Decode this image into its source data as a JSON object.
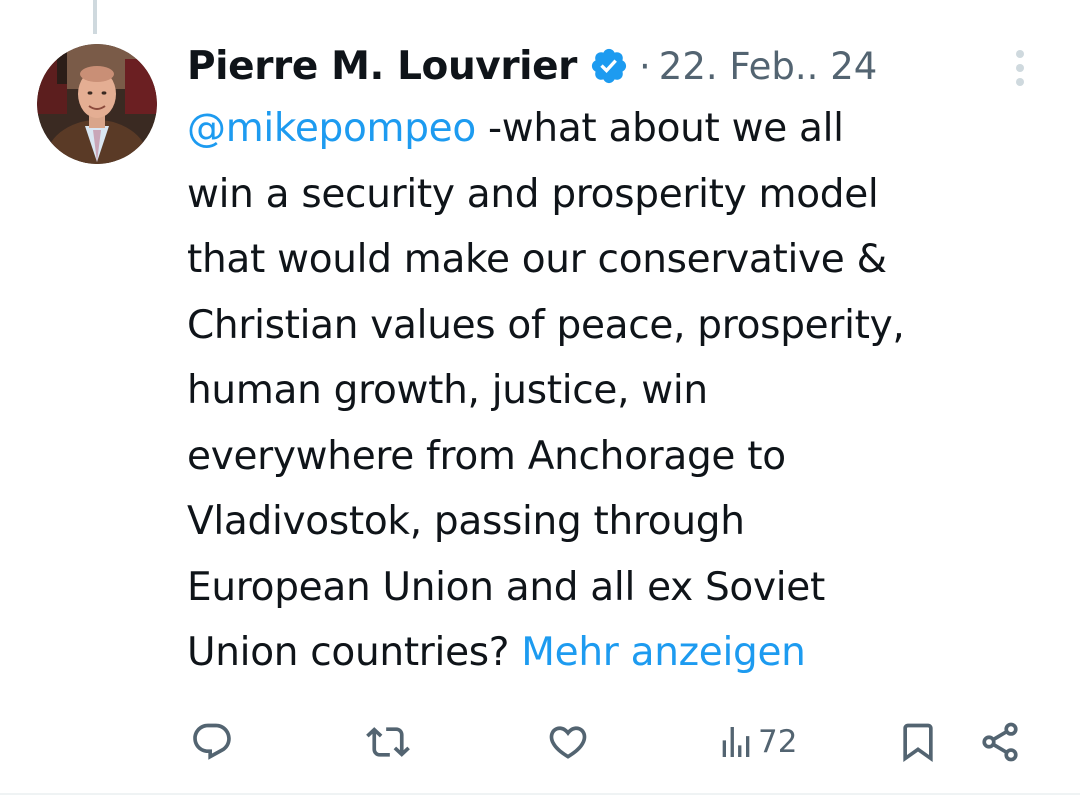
{
  "tweet": {
    "author": {
      "name": "Pierre M. Louvrier",
      "verified_icon": "verified-badge-icon",
      "avatar_icon": "avatar-photo"
    },
    "separator": "·",
    "date": "22. Feb.. 24",
    "text": {
      "line1": {
        "mention": "@mikepompeo",
        "rest": " -what about we all"
      },
      "line2": "win a security and prosperity model",
      "line3": "that would make our conservative &",
      "line4": "Christian values of peace, prosperity,",
      "line5": "human growth, justice, win",
      "line6": "everywhere from Anchorage to",
      "line7": "Vladivostok, passing through",
      "line8": "European Union and all ex Soviet",
      "line9": {
        "rest": "Union countries? ",
        "show_more": "Mehr anzeigen"
      }
    },
    "actions": {
      "reply_icon": "reply-icon",
      "retweet_icon": "retweet-icon",
      "like_icon": "like-icon",
      "views_icon": "views-icon",
      "views_count": "72",
      "bookmark_icon": "bookmark-icon",
      "share_icon": "share-icon"
    }
  },
  "colors": {
    "text": "#0f1419",
    "secondary": "#536471",
    "link": "#1d9bf0",
    "verified": "#1d9bf0"
  }
}
